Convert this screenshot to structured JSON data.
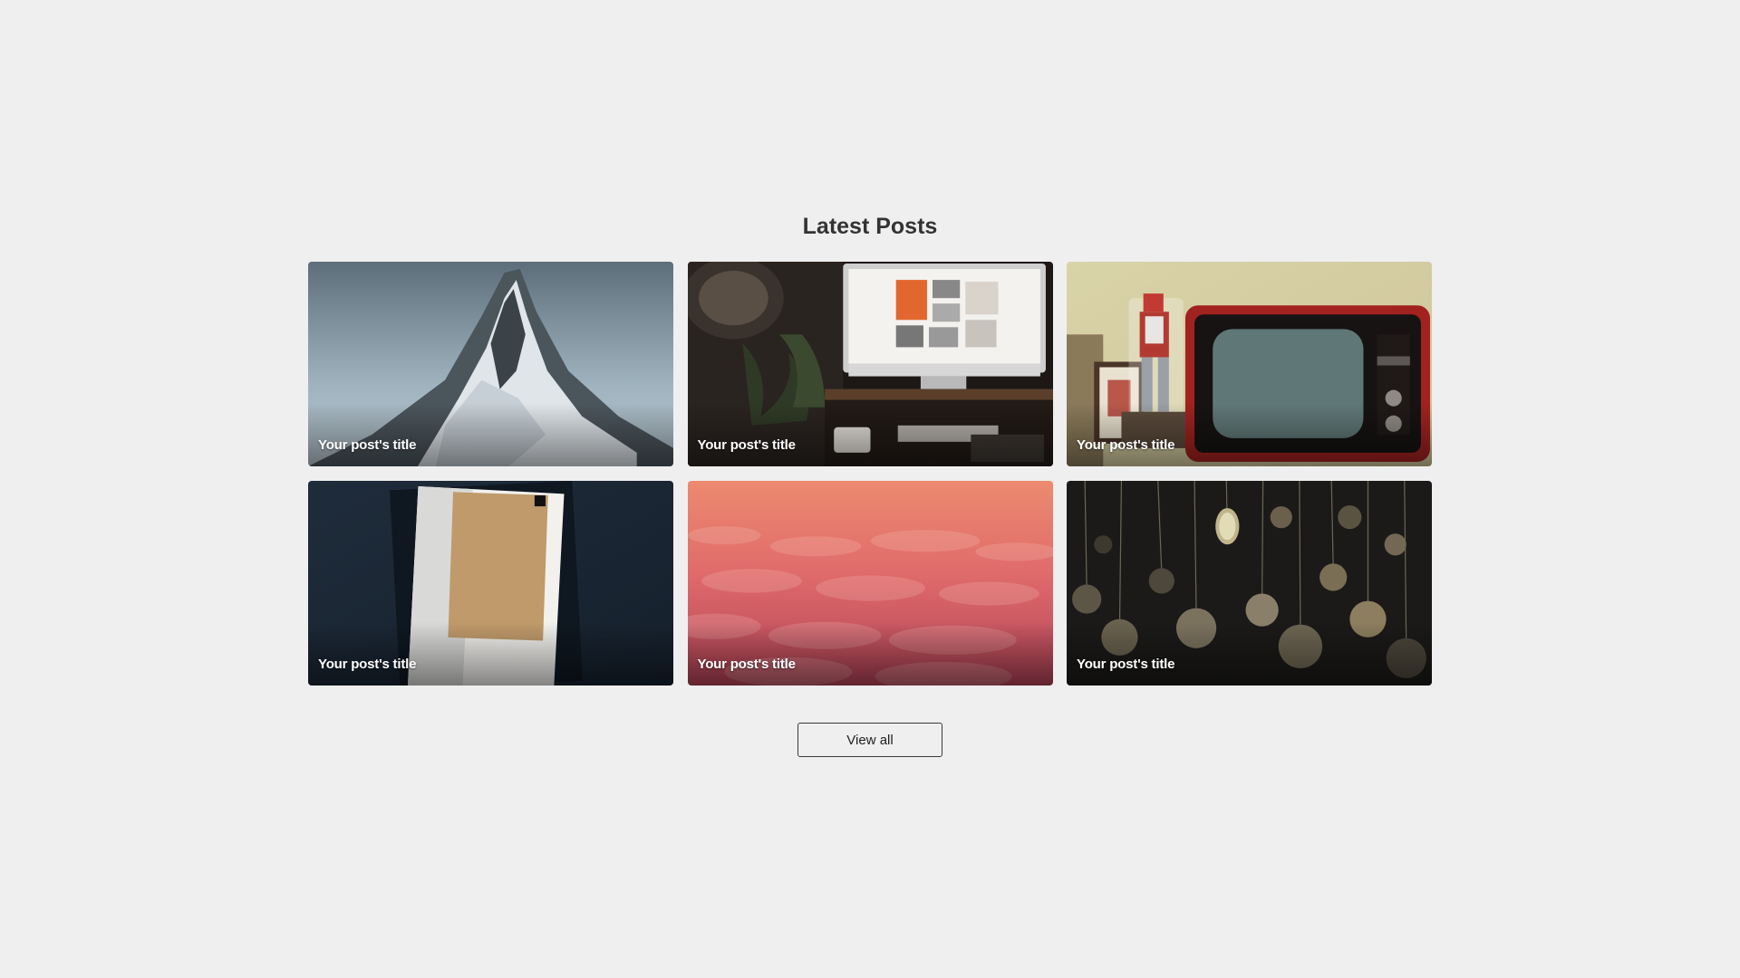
{
  "section": {
    "heading": "Latest Posts",
    "button_label": "View all"
  },
  "posts": [
    {
      "title": "Your post's title",
      "image": "snowy-mountain-peak"
    },
    {
      "title": "Your post's title",
      "image": "desk-with-computer-and-plants"
    },
    {
      "title": "Your post's title",
      "image": "retro-tv-and-robot-toy"
    },
    {
      "title": "Your post's title",
      "image": "notebook-on-dark-fabric"
    },
    {
      "title": "Your post's title",
      "image": "pink-clouds-aerial"
    },
    {
      "title": "Your post's title",
      "image": "hanging-pocket-watches"
    }
  ],
  "colors": {
    "background": "#efefef",
    "heading": "#333333",
    "card_title": "#ffffff",
    "button_border": "#3a3a3a"
  }
}
